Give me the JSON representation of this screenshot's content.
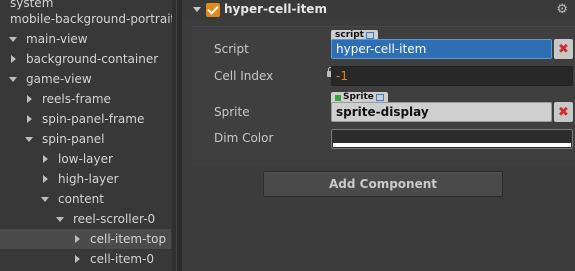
{
  "hierarchy": {
    "items": [
      {
        "label": "system",
        "arrow": "none"
      },
      {
        "label": "mobile-background-portrait",
        "arrow": "none"
      },
      {
        "label": "main-view",
        "arrow": "down"
      },
      {
        "label": "background-container",
        "arrow": "right"
      },
      {
        "label": "game-view",
        "arrow": "down"
      },
      {
        "label": "reels-frame",
        "arrow": "right"
      },
      {
        "label": "spin-panel-frame",
        "arrow": "right"
      },
      {
        "label": "spin-panel",
        "arrow": "down"
      },
      {
        "label": "low-layer",
        "arrow": "right"
      },
      {
        "label": "high-layer",
        "arrow": "right"
      },
      {
        "label": "content",
        "arrow": "down"
      },
      {
        "label": "reel-scroller-0",
        "arrow": "down"
      },
      {
        "label": "cell-item-top",
        "arrow": "right",
        "selected": true
      },
      {
        "label": "cell-item-0",
        "arrow": "right"
      }
    ]
  },
  "inspector": {
    "component_title": "hyper-cell-item",
    "component_enabled": true,
    "gear_icon": "gear-icon",
    "props": {
      "script_label": "Script",
      "script_tag": "script",
      "script_value": "hyper-cell-item",
      "cell_index_label": "Cell Index",
      "cell_index_value": "-1",
      "sprite_label": "Sprite",
      "sprite_tag": "Sprite",
      "sprite_value": "sprite-display",
      "dim_color_label": "Dim Color",
      "dim_color_value": "#ffffff"
    },
    "clear_symbol": "✖",
    "add_component_label": "Add Component"
  },
  "colors": {
    "accent_orange": "#e08a1e",
    "script_field_blue": "#2e6fb3",
    "cell_index_orange": "#e07f2a",
    "clear_red": "#d12b2b"
  }
}
